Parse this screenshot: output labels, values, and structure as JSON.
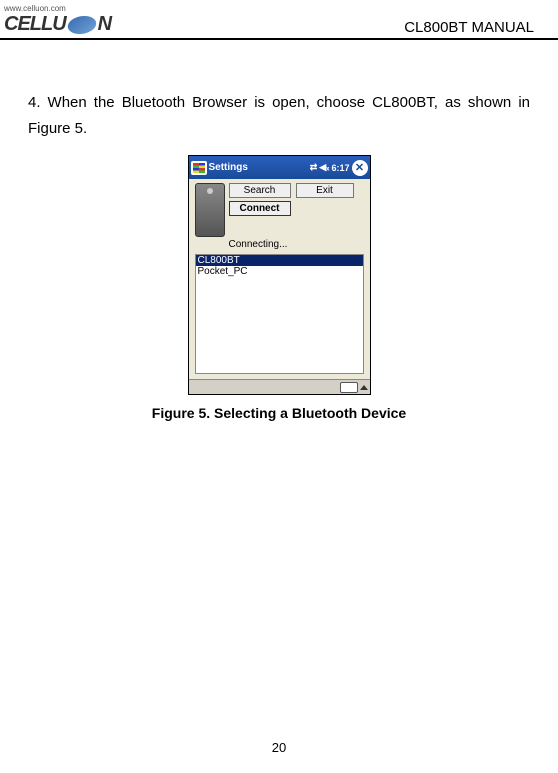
{
  "header": {
    "site": "www.celluon.com",
    "logo_left": "CELLU",
    "logo_right": "N",
    "doc_title": "CL800BT MANUAL"
  },
  "body": {
    "paragraph": "4. When the Bluetooth Browser is open, choose CL800BT, as shown in Figure 5."
  },
  "screenshot": {
    "taskbar": {
      "title": "Settings",
      "signal": "⇄",
      "volume": "◀ₓ",
      "time": "6:17",
      "close": "✕"
    },
    "buttons": {
      "search": "Search",
      "exit": "Exit",
      "connect": "Connect"
    },
    "status": "Connecting...",
    "devices": {
      "selected": "CL800BT",
      "other": "Pocket_PC"
    }
  },
  "caption": "Figure 5. Selecting a Bluetooth Device",
  "page_number": "20"
}
